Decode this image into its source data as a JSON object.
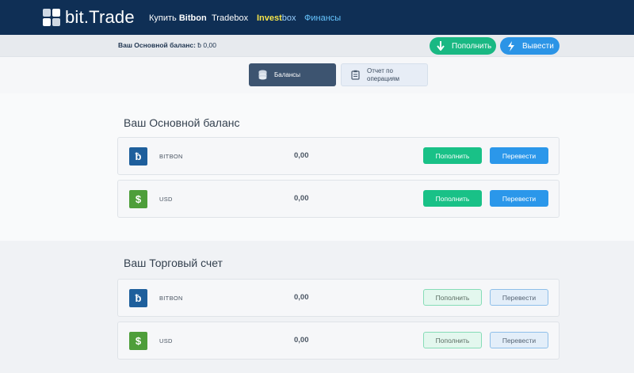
{
  "nav": {
    "logo_text": "bit.Trade",
    "buy_prefix": "Купить ",
    "buy_bold": "Bitbon",
    "tradebox": "Tradebox",
    "invest_part1": "Invest",
    "invest_part2": "box",
    "finance": "Финансы"
  },
  "balance_strip": {
    "label": "Ваш Основной баланс:",
    "value": "ƀ 0,00",
    "deposit_label": "Пополнить",
    "withdraw_label": "Вывести",
    "deposit_icon": "arrow-down-icon",
    "withdraw_icon": "lightning-icon"
  },
  "tabs": [
    {
      "label": "Балансы",
      "icon": "coins-stack-icon",
      "active": true
    },
    {
      "label": "Отчет по операциям",
      "line1": "Отчет по",
      "line2": "операциям",
      "icon": "clipboard-icon",
      "active": false
    }
  ],
  "sections": {
    "main": {
      "title": "Ваш Основной баланс",
      "rows": [
        {
          "currency": "BITBON",
          "amount": "0,00",
          "icon_glyph": "ƀ",
          "deposit": "Пополнить",
          "transfer": "Перевести"
        },
        {
          "currency": "USD",
          "amount": "0,00",
          "icon_glyph": "$",
          "deposit": "Пополнить",
          "transfer": "Перевести"
        }
      ]
    },
    "trade": {
      "title": "Ваш Торговый счет",
      "rows": [
        {
          "currency": "BITBON",
          "amount": "0,00",
          "icon_glyph": "ƀ",
          "deposit": "Пополнить",
          "transfer": "Перевести"
        },
        {
          "currency": "USD",
          "amount": "0,00",
          "icon_glyph": "$",
          "deposit": "Пополнить",
          "transfer": "Перевести"
        }
      ]
    }
  },
  "colors": {
    "nav_bg": "#0f2f55",
    "accent_green": "#19c187",
    "accent_blue": "#2b97ea",
    "invest_yellow": "#f5e44a",
    "finance_blue": "#67c6ff"
  }
}
